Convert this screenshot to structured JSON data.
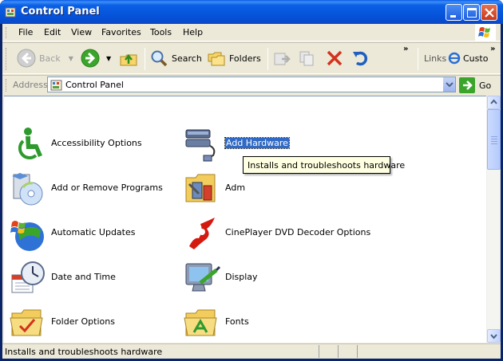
{
  "window": {
    "title": "Control Panel"
  },
  "menu": [
    "File",
    "Edit",
    "View",
    "Favorites",
    "Tools",
    "Help"
  ],
  "toolbar": {
    "back_label": "Back",
    "search_label": "Search",
    "folders_label": "Folders",
    "links_label": "Links",
    "custom_label": "Custo",
    "chevron": "»"
  },
  "address": {
    "label": "Address",
    "value": "Control Panel",
    "go_label": "Go"
  },
  "items": [
    {
      "label": "Accessibility Options",
      "icon": "accessibility-icon"
    },
    {
      "label": "Add Hardware",
      "icon": "add-hardware-icon",
      "selected": true
    },
    {
      "label": "Add or Remove Programs",
      "icon": "add-remove-programs-icon"
    },
    {
      "label": "Adm",
      "icon": "administrative-tools-icon"
    },
    {
      "label": "Automatic Updates",
      "icon": "automatic-updates-icon"
    },
    {
      "label": "CinePlayer DVD Decoder Options",
      "icon": "cineplayer-icon"
    },
    {
      "label": "Date and Time",
      "icon": "date-time-icon"
    },
    {
      "label": "Display",
      "icon": "display-icon"
    },
    {
      "label": "Folder Options",
      "icon": "folder-options-icon"
    },
    {
      "label": "Fonts",
      "icon": "fonts-icon"
    }
  ],
  "tooltip": "Installs and troubleshoots hardware",
  "status": "Installs and troubleshoots hardware",
  "colors": {
    "titlebar": "#0552d8",
    "selection": "#316ac5",
    "tooltip_bg": "#ffffe1"
  }
}
